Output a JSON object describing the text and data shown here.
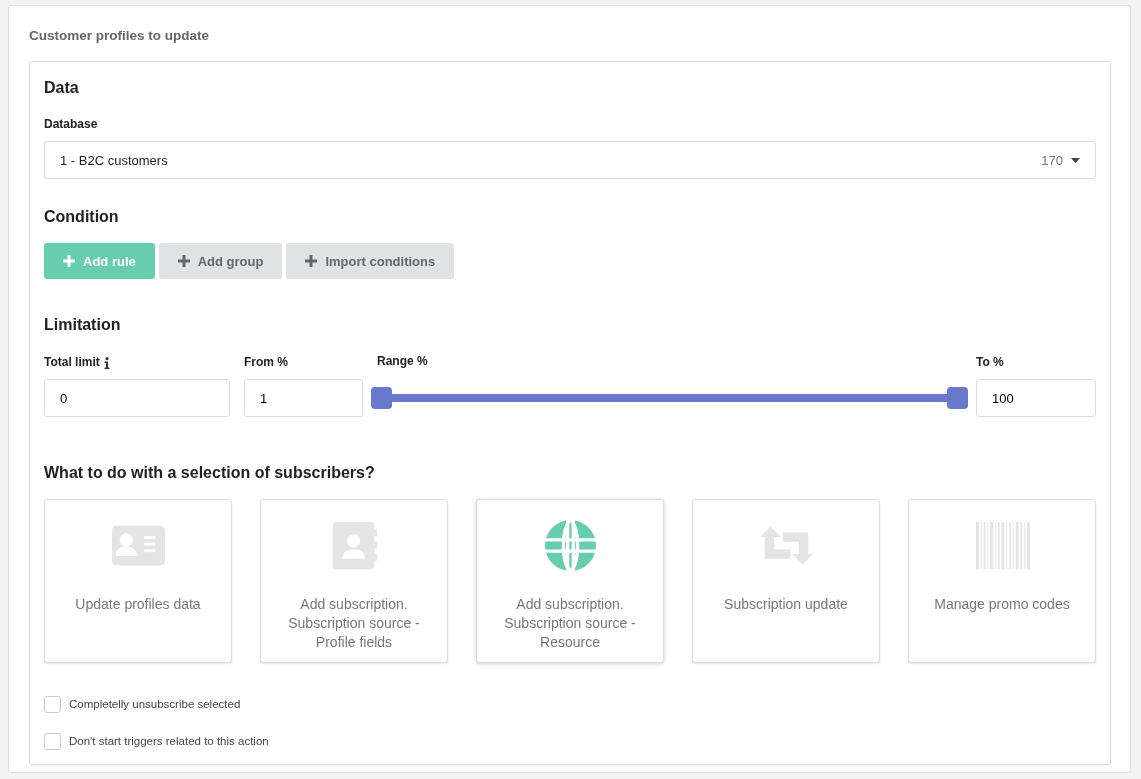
{
  "panel_title": "Customer profiles to update",
  "data_section": {
    "heading": "Data",
    "database_label": "Database",
    "database_value": "1 - B2C customers",
    "database_count": "170"
  },
  "condition_section": {
    "heading": "Condition",
    "buttons": [
      {
        "label": "Add rule",
        "kind": "primary"
      },
      {
        "label": "Add group",
        "kind": "secondary"
      },
      {
        "label": "Import conditions",
        "kind": "secondary"
      }
    ]
  },
  "limitation_section": {
    "heading": "Limitation",
    "total_limit_label": "Total limit",
    "total_limit_value": "0",
    "from_label": "From %",
    "from_value": "1",
    "range_label": "Range %",
    "range_thumbs": [
      {
        "level": 0
      },
      {
        "level": 1
      }
    ],
    "to_label": "To %",
    "to_value": "100"
  },
  "actions_section": {
    "heading": "What to do with a selection of subscribers?",
    "actions": [
      {
        "label": "Update profiles data",
        "kind": "id-card",
        "selected": false
      },
      {
        "label": "Add subscription. Subscription source - Profile fields",
        "kind": "contact-book",
        "selected": false
      },
      {
        "label": "Add subscription. Subscription source - Resource",
        "kind": "globe",
        "selected": true
      },
      {
        "label": "Subscription update",
        "kind": "repeat",
        "selected": false
      },
      {
        "label": "Manage promo codes",
        "kind": "barcode",
        "selected": false
      }
    ]
  },
  "options": [
    {
      "label": "Completelly unsubscribe selected",
      "checked": false
    },
    {
      "label": "Don't start triggers related to this action",
      "checked": false
    }
  ]
}
